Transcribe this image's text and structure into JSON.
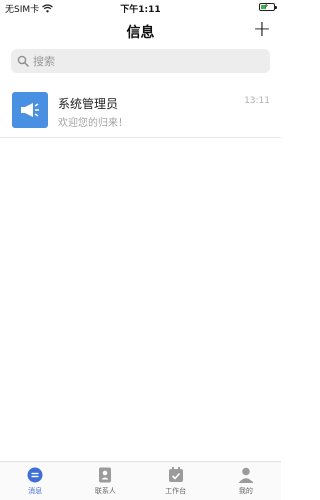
{
  "status_bar": {
    "carrier": "无SIM卡",
    "time": "下午1:11"
  },
  "nav": {
    "title": "信息",
    "add_label": "+"
  },
  "search": {
    "placeholder": "搜索"
  },
  "conversations": [
    {
      "name": "系统管理员",
      "preview": "欢迎您的归来！",
      "time": "13:11",
      "avatar_icon": "megaphone-icon",
      "avatar_color": "#4a90e2"
    }
  ],
  "tabs": [
    {
      "label": "消息",
      "icon": "message-icon",
      "active": true
    },
    {
      "label": "联系人",
      "icon": "contacts-icon",
      "active": false
    },
    {
      "label": "工作台",
      "icon": "workbench-icon",
      "active": false
    },
    {
      "label": "我的",
      "icon": "profile-icon",
      "active": false
    }
  ],
  "colors": {
    "accent": "#3f6fd6",
    "inactive_icon": "#9b9b9b"
  }
}
